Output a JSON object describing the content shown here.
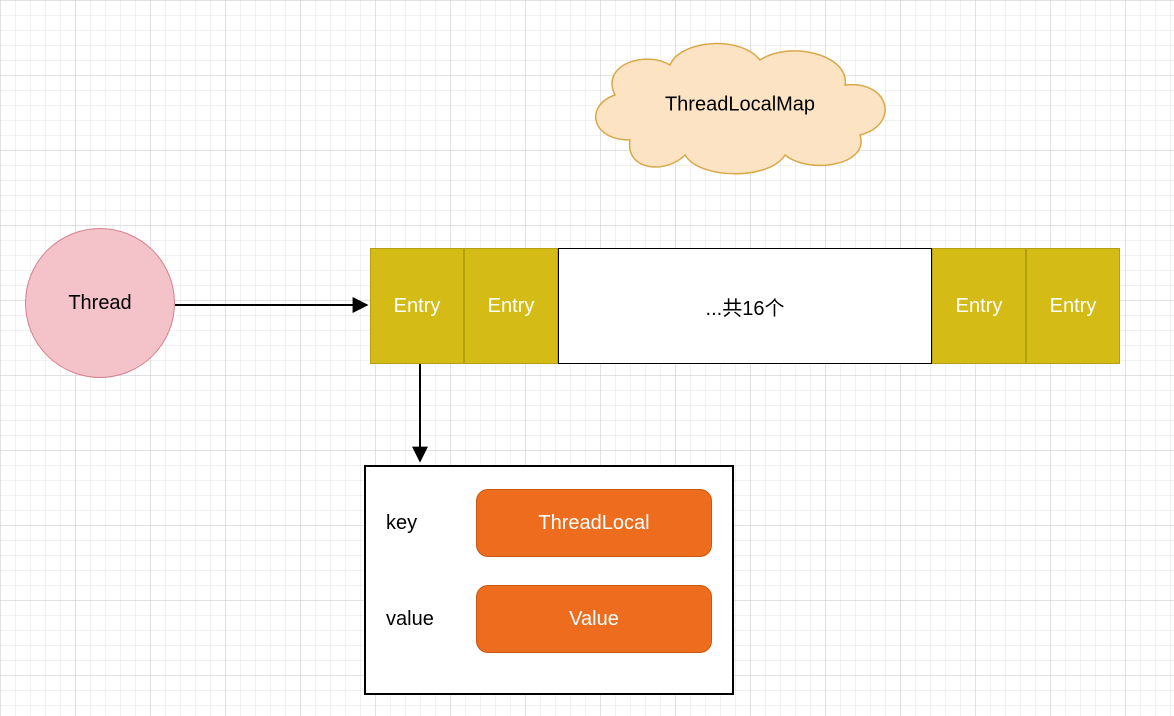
{
  "cloud": {
    "label": "ThreadLocalMap"
  },
  "thread": {
    "label": "Thread"
  },
  "entries": {
    "label": "Entry",
    "middle": "...共16个"
  },
  "detail": {
    "keyLabel": "key",
    "keyValue": "ThreadLocal",
    "valueLabel": "value",
    "valueValue": "Value"
  }
}
